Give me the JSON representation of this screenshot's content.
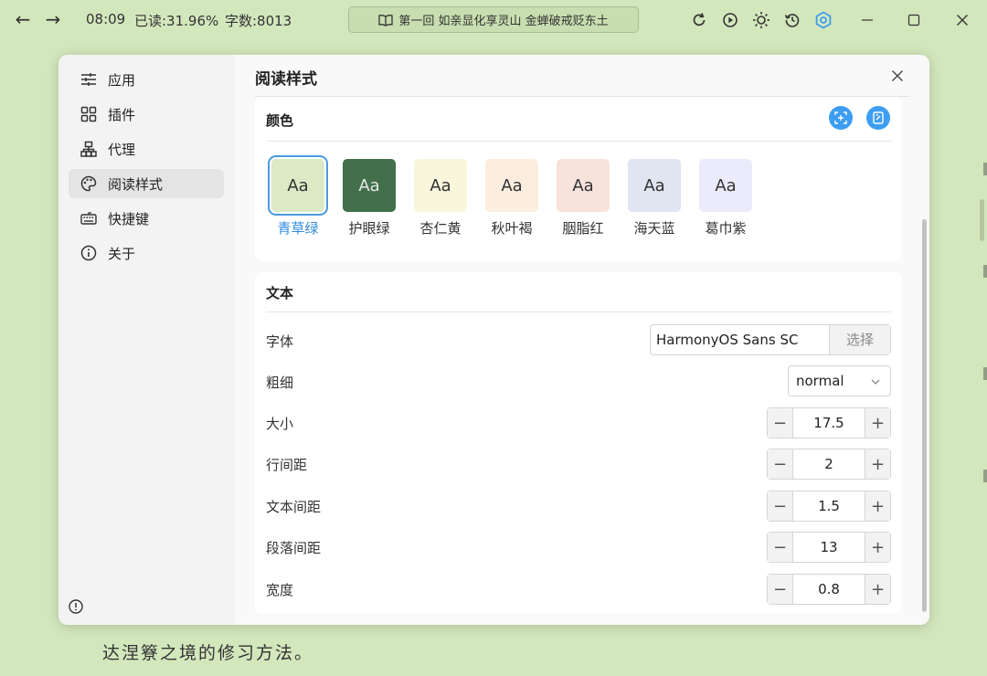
{
  "topbar": {
    "time": "08:09",
    "read_progress": "已读:31.96%",
    "word_count": "字数:8013",
    "chapter_title": "第一回 如亲显化享灵山 金蝉破戒贬东土"
  },
  "background": {
    "reading_text": "达涅簝之境的修习方法。"
  },
  "sidebar": {
    "items": [
      {
        "label": "应用",
        "icon": "sliders-icon"
      },
      {
        "label": "插件",
        "icon": "grid-icon"
      },
      {
        "label": "代理",
        "icon": "network-icon"
      },
      {
        "label": "阅读样式",
        "icon": "palette-icon"
      },
      {
        "label": "快捷键",
        "icon": "keyboard-icon"
      },
      {
        "label": "关于",
        "icon": "info-icon"
      }
    ],
    "active_index": 3
  },
  "main": {
    "title": "阅读样式",
    "color_section": {
      "title": "颜色",
      "swatches": [
        {
          "sample": "Aa",
          "label": "青草绿",
          "bg": "#dbe9c5",
          "fg": "#333333",
          "selected": true
        },
        {
          "sample": "Aa",
          "label": "护眼绿",
          "bg": "#41704a",
          "fg": "#e8e8e8",
          "selected": false
        },
        {
          "sample": "Aa",
          "label": "杏仁黄",
          "bg": "#f8f6db",
          "fg": "#333333",
          "selected": false
        },
        {
          "sample": "Aa",
          "label": "秋叶褐",
          "bg": "#fbeedf",
          "fg": "#333333",
          "selected": false
        },
        {
          "sample": "Aa",
          "label": "胭脂红",
          "bg": "#f8e3dc",
          "fg": "#333333",
          "selected": false
        },
        {
          "sample": "Aa",
          "label": "海天蓝",
          "bg": "#dfe5f1",
          "fg": "#333333",
          "selected": false
        },
        {
          "sample": "Aa",
          "label": "葛巾紫",
          "bg": "#ecebfb",
          "fg": "#333333",
          "selected": false
        }
      ]
    },
    "text_section": {
      "title": "文本",
      "font": {
        "label": "字体",
        "value": "HarmonyOS Sans SC",
        "button": "选择"
      },
      "weight": {
        "label": "粗细",
        "value": "normal"
      },
      "size": {
        "label": "大小",
        "value": "17.5"
      },
      "line_height": {
        "label": "行间距",
        "value": "2"
      },
      "letter_spacing": {
        "label": "文本间距",
        "value": "1.5"
      },
      "paragraph_spacing": {
        "label": "段落间距",
        "value": "13"
      },
      "width": {
        "label": "宽度",
        "value": "0.8"
      }
    }
  },
  "colors": {
    "accent": "#3d9df2",
    "page_bg": "#d3e7bc"
  }
}
